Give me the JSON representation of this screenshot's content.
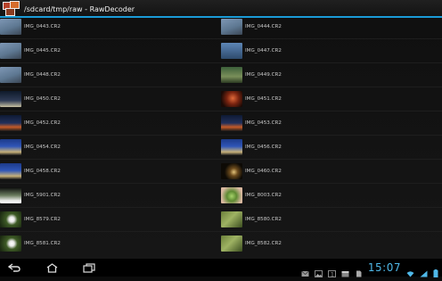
{
  "app": {
    "title": "/sdcard/tmp/raw - RawDecoder",
    "accent": "#1a9bd7"
  },
  "files": [
    {
      "name": "IMG_0443.CR2",
      "thumb": "sky-branches"
    },
    {
      "name": "IMG_0444.CR2",
      "thumb": "sky-branches"
    },
    {
      "name": "IMG_0445.CR2",
      "thumb": "sky-branches"
    },
    {
      "name": "IMG_0447.CR2",
      "thumb": "sky-blue"
    },
    {
      "name": "IMG_0448.CR2",
      "thumb": "sky-branches"
    },
    {
      "name": "IMG_0449.CR2",
      "thumb": "garden-green"
    },
    {
      "name": "IMG_0450.CR2",
      "thumb": "night-city"
    },
    {
      "name": "IMG_0451.CR2",
      "thumb": "red-light"
    },
    {
      "name": "IMG_0452.CR2",
      "thumb": "night-sunset"
    },
    {
      "name": "IMG_0453.CR2",
      "thumb": "night-sunset"
    },
    {
      "name": "IMG_0454.CR2",
      "thumb": "night-blue"
    },
    {
      "name": "IMG_0456.CR2",
      "thumb": "night-blue"
    },
    {
      "name": "IMG_0458.CR2",
      "thumb": "night-blue"
    },
    {
      "name": "IMG_0460.CR2",
      "thumb": "dark-lamp"
    },
    {
      "name": "IMG_5901.CR2",
      "thumb": "green-white"
    },
    {
      "name": "IMG_8003.CR2",
      "thumb": "green-lizard"
    },
    {
      "name": "IMG_8579.CR2",
      "thumb": "white-flower"
    },
    {
      "name": "IMG_8580.CR2",
      "thumb": "leaves"
    },
    {
      "name": "IMG_8581.CR2",
      "thumb": "white-flower"
    },
    {
      "name": "IMG_8582.CR2",
      "thumb": "leaves"
    }
  ],
  "navbar": {
    "back_icon": "back-icon",
    "home_icon": "home-icon",
    "recents_icon": "recent-apps-icon"
  },
  "status": {
    "time": "15:07",
    "icons": [
      "email-icon",
      "gallery-icon",
      "notification-1-icon",
      "calendar-icon",
      "file-icon",
      "wifi-icon",
      "signal-icon",
      "battery-icon"
    ]
  }
}
